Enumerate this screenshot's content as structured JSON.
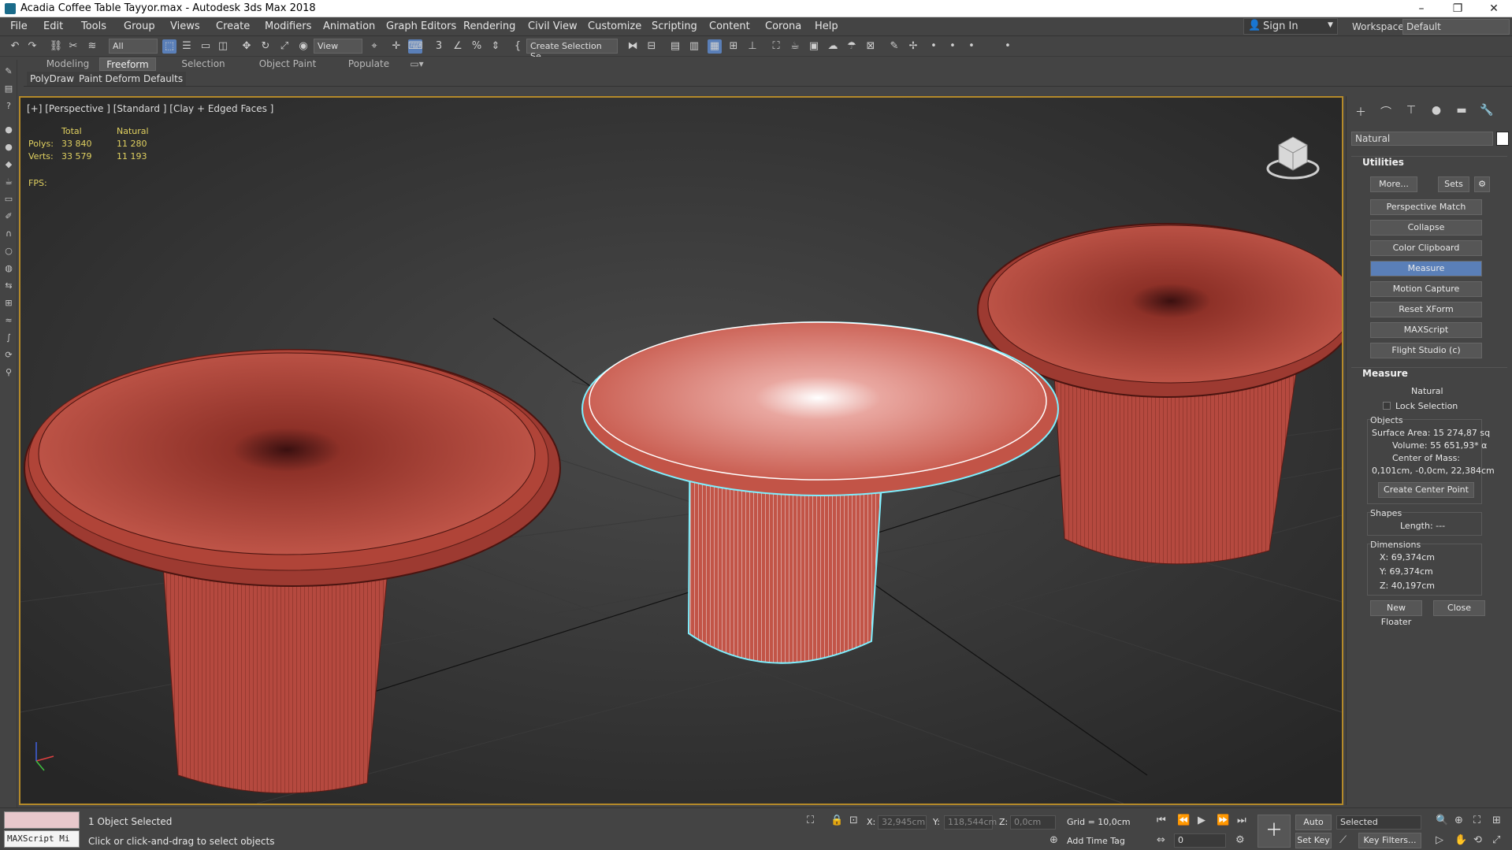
{
  "window": {
    "title": "Acadia Coffee Table Tayyor.max - Autodesk 3ds Max 2018",
    "minimize": "–",
    "maximize": "❐",
    "close": "✕"
  },
  "menu": [
    "File",
    "Edit",
    "Tools",
    "Group",
    "Views",
    "Create",
    "Modifiers",
    "Animation",
    "Graph Editors",
    "Rendering",
    "Civil View",
    "Customize",
    "Scripting",
    "Content",
    "Corona",
    "Help"
  ],
  "account": {
    "sign_in": "Sign In",
    "workspaces_label": "Workspaces:",
    "workspace": "Default"
  },
  "toolbar": {
    "filter": "All",
    "ref_coord": "View",
    "selection_set": "Create Selection Se"
  },
  "ribbon": {
    "tabs": [
      "Modeling",
      "Freeform",
      "Selection",
      "Object Paint",
      "Populate"
    ],
    "active_tab": "Freeform",
    "sub": [
      "PolyDraw",
      "Paint Deform",
      "Defaults"
    ]
  },
  "viewport": {
    "label": "[+] [Perspective ] [Standard ] [Clay + Edged Faces ]",
    "stats": {
      "total_header": "Total",
      "natural_header": "Natural",
      "polys_label": "Polys:",
      "polys_total": "33 840",
      "polys_natural": "11 280",
      "verts_label": "Verts:",
      "verts_total": "33 579",
      "verts_natural": "11 193",
      "fps_label": "FPS:"
    }
  },
  "command_panel": {
    "object_name": "Natural",
    "utilities_title": "Utilities",
    "more": "More...",
    "sets": "Sets",
    "utility_buttons": [
      "Perspective Match",
      "Collapse",
      "Color Clipboard",
      "Measure",
      "Motion Capture",
      "Reset XForm",
      "MAXScript",
      "Flight Studio (c)"
    ],
    "selected_utility": "Measure",
    "measure": {
      "title": "Measure",
      "object": "Natural",
      "lock_selection": "Lock Selection",
      "objects_label": "Objects",
      "surface_area": "Surface Area:  15 274,87 sq",
      "volume": "Volume:  55 651,93* α",
      "center_of_mass_label": "Center of Mass:",
      "center_of_mass": "0,101cm, -0,0cm, 22,384cm",
      "create_center_point": "Create Center Point",
      "shapes_label": "Shapes",
      "length": "Length: ---",
      "dimensions_label": "Dimensions",
      "dim_x": "X:  69,374cm",
      "dim_y": "Y:  69,374cm",
      "dim_z": "Z:  40,197cm",
      "new_floater": "New Floater",
      "close": "Close"
    }
  },
  "status": {
    "maxscript_placeholder": "MAXScript Mi",
    "selection": "1 Object Selected",
    "prompt": "Click or click-and-drag to select objects",
    "x_label": "X:",
    "x_value": "32,945cm",
    "y_label": "Y:",
    "y_value": "118,544cm",
    "z_label": "Z:",
    "z_value": "0,0cm",
    "grid": "Grid = 10,0cm",
    "add_time_tag": "Add Time Tag",
    "auto_key": "Auto Key",
    "set_key": "Set Key",
    "key_mode": "Selected",
    "frame": "0",
    "key_filters": "Key Filters..."
  },
  "colors": {
    "viewport_border": "#b48a2a",
    "selected_button": "#5a7fb8",
    "stats_text": "#e0d060",
    "table_wire": "#7a2a22",
    "table_fill": "#b5493f",
    "selection_outline": "#7ff0ff"
  }
}
